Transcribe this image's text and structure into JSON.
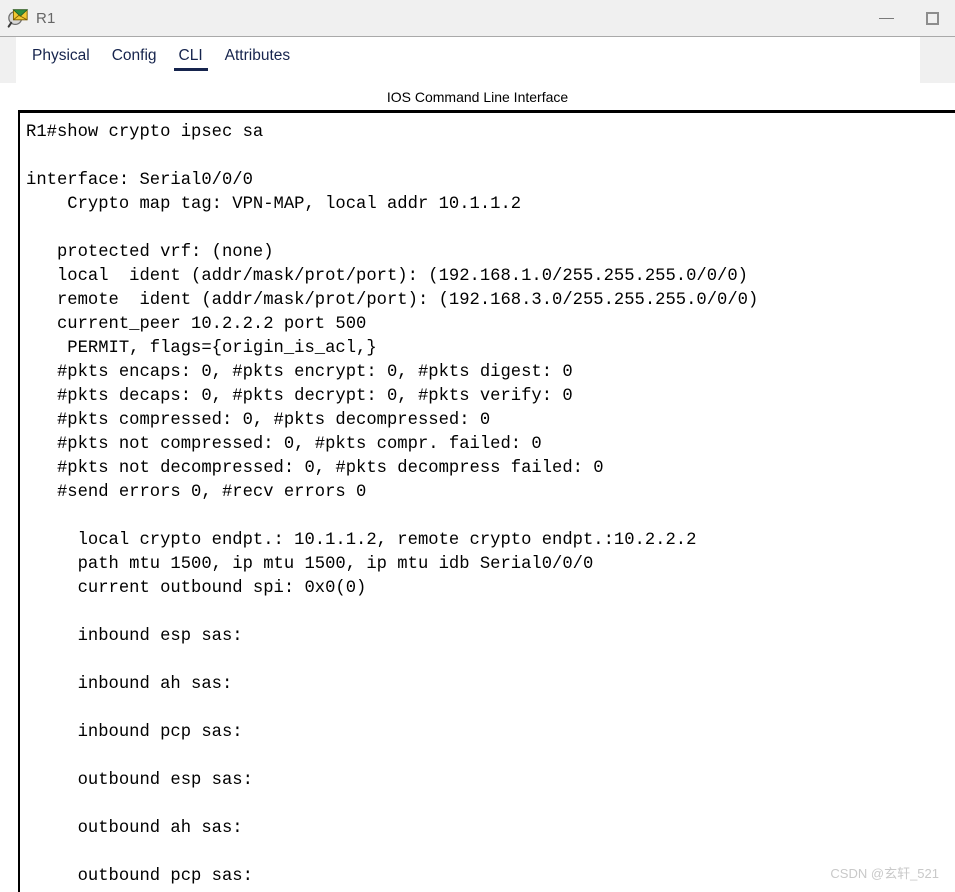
{
  "window": {
    "title": "R1",
    "icon": "packet-tracer-envelope-icon",
    "controls": {
      "minimize_label": "—",
      "maximize_label": "□"
    }
  },
  "tabs": [
    {
      "label": "Physical",
      "active": false
    },
    {
      "label": "Config",
      "active": false
    },
    {
      "label": "CLI",
      "active": true
    },
    {
      "label": "Attributes",
      "active": false
    }
  ],
  "cli": {
    "header": "IOS Command Line Interface",
    "lines": [
      "R1#show crypto ipsec sa",
      "",
      "interface: Serial0/0/0",
      "    Crypto map tag: VPN-MAP, local addr 10.1.1.2",
      "",
      "   protected vrf: (none)",
      "   local  ident (addr/mask/prot/port): (192.168.1.0/255.255.255.0/0/0)",
      "   remote  ident (addr/mask/prot/port): (192.168.3.0/255.255.255.0/0/0)",
      "   current_peer 10.2.2.2 port 500",
      "    PERMIT, flags={origin_is_acl,}",
      "   #pkts encaps: 0, #pkts encrypt: 0, #pkts digest: 0",
      "   #pkts decaps: 0, #pkts decrypt: 0, #pkts verify: 0",
      "   #pkts compressed: 0, #pkts decompressed: 0",
      "   #pkts not compressed: 0, #pkts compr. failed: 0",
      "   #pkts not decompressed: 0, #pkts decompress failed: 0",
      "   #send errors 0, #recv errors 0",
      "",
      "     local crypto endpt.: 10.1.1.2, remote crypto endpt.:10.2.2.2",
      "     path mtu 1500, ip mtu 1500, ip mtu idb Serial0/0/0",
      "     current outbound spi: 0x0(0)",
      "",
      "     inbound esp sas:",
      "",
      "     inbound ah sas:",
      "",
      "     inbound pcp sas:",
      "",
      "     outbound esp sas:",
      "",
      "     outbound ah sas:",
      "",
      "     outbound pcp sas:"
    ]
  },
  "watermark": {
    "text": "CSDN @玄轩_521"
  },
  "colors": {
    "chrome": "#f0f0f0",
    "tab_text": "#16244d",
    "terminal_text": "#000000",
    "title_text": "#666666",
    "watermark": "#c9c9c9"
  }
}
